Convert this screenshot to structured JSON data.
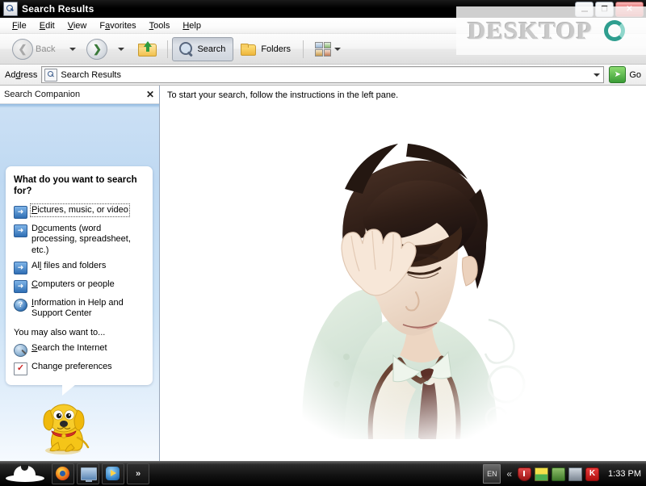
{
  "window": {
    "title": "Search Results",
    "title_icon": "search-document-icon",
    "controls": {
      "minimize": "_",
      "restore": "❐",
      "close": "✕"
    }
  },
  "menubar": {
    "items": [
      {
        "label": "File",
        "accel": "F"
      },
      {
        "label": "Edit",
        "accel": "E"
      },
      {
        "label": "View",
        "accel": "V"
      },
      {
        "label": "Favorites",
        "accel": "a"
      },
      {
        "label": "Tools",
        "accel": "T"
      },
      {
        "label": "Help",
        "accel": "H"
      }
    ]
  },
  "toolbar": {
    "back_label": "Back",
    "back_icon": "back-arrow-icon",
    "forward_icon": "forward-arrow-icon",
    "up_icon": "up-folder-icon",
    "search_label": "Search",
    "search_icon": "magnifier-icon",
    "folders_label": "Folders",
    "folders_icon": "folder-icon",
    "views_icon": "views-thumbnails-icon"
  },
  "addressbar": {
    "label": "Address",
    "label_accel": "d",
    "value": "Search Results",
    "icon": "search-document-icon",
    "dropdown_icon": "chevron-down-icon",
    "go_label": "Go",
    "go_icon": "green-arrow-icon"
  },
  "search_companion": {
    "header": "Search Companion",
    "close_icon": "close-icon",
    "heading": "What do you want to search for?",
    "options": [
      {
        "label": "Pictures, music, or video",
        "accel": "P",
        "icon": "blue-arrow-icon",
        "focused": true
      },
      {
        "label": "Documents (word processing, spreadsheet, etc.)",
        "accel": "o",
        "icon": "blue-arrow-icon",
        "focused": false
      },
      {
        "label": "All files and folders",
        "accel": "l",
        "icon": "blue-arrow-icon",
        "focused": false
      },
      {
        "label": "Computers or people",
        "accel": "C",
        "icon": "blue-arrow-icon",
        "focused": false
      },
      {
        "label": "Information in Help and Support Center",
        "accel": "I",
        "icon": "help-question-icon",
        "focused": false
      }
    ],
    "also_heading": "You may also want to...",
    "also_options": [
      {
        "label": "Search the Internet",
        "accel": "S",
        "icon": "globe-search-icon"
      },
      {
        "label": "Change preferences",
        "accel": "g",
        "icon": "checkbox-icon"
      }
    ],
    "mascot": "rover-dog-icon"
  },
  "results": {
    "message": "To start your search, follow the instructions in the left pane.",
    "photo_alt": "portrait-photo"
  },
  "watermark": {
    "text": "DESKTOP",
    "logo": "teal-ring-logo"
  },
  "taskbar": {
    "start_icon": "white-fedora-hat-icon",
    "quick_launch": [
      {
        "name": "firefox-icon"
      },
      {
        "name": "show-desktop-icon"
      },
      {
        "name": "media-player-icon"
      },
      {
        "name": "expand-chevron-icon",
        "glyph": "»"
      }
    ],
    "tray": {
      "language": "EN",
      "expand_glyph": "«",
      "icons": [
        {
          "name": "security-shield-icon"
        },
        {
          "name": "calendar-icon"
        },
        {
          "name": "network-icon"
        },
        {
          "name": "monitor-icon"
        },
        {
          "name": "kaspersky-icon"
        }
      ],
      "clock": "1:33 PM"
    }
  }
}
